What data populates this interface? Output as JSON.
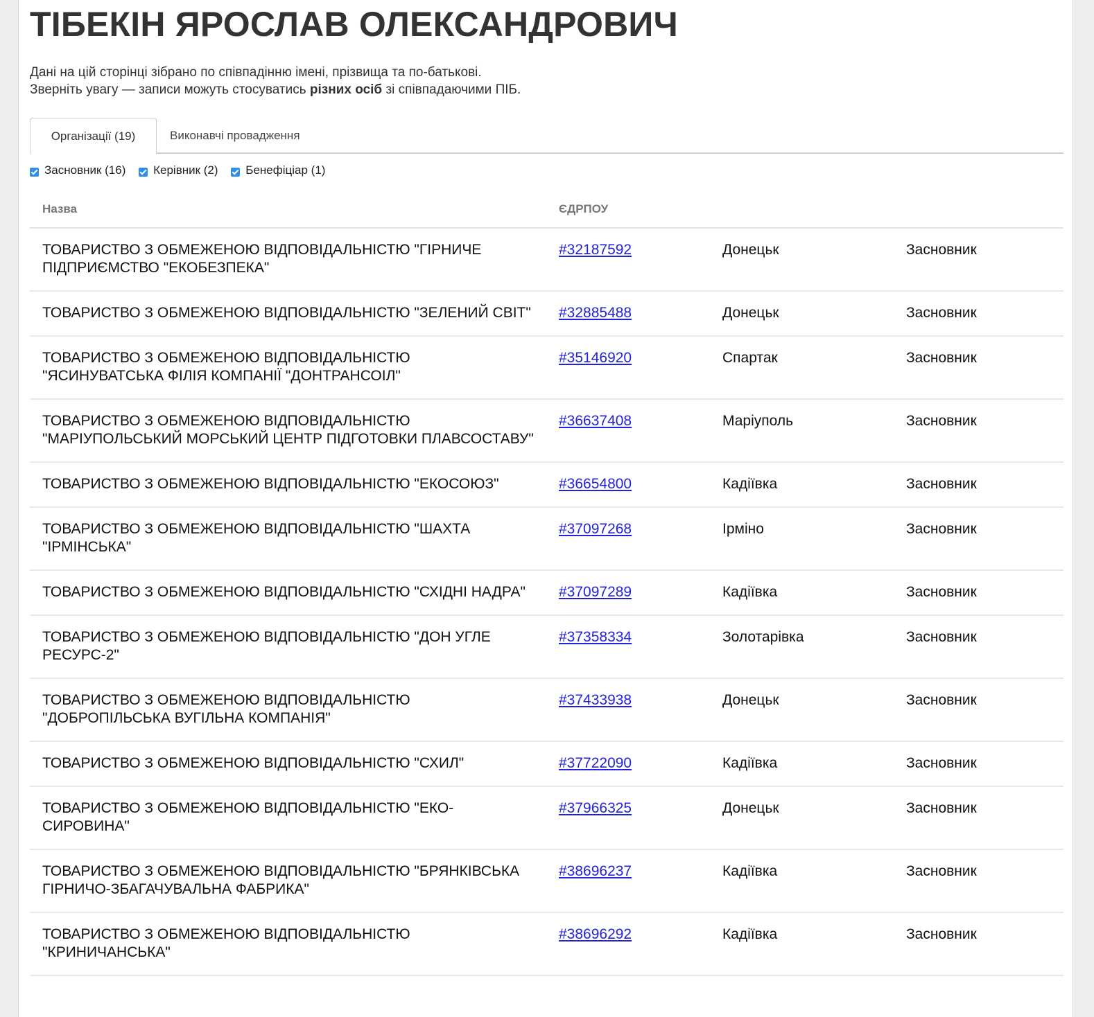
{
  "person": {
    "name": "ТІБЕКІН ЯРОСЛАВ ОЛЕКСАНДРОВИЧ"
  },
  "notice": {
    "line1": "Дані на цій сторінці зібрано по співпадінню імені, прізвища та по-батькові.",
    "line2_before": "Зверніть увагу — записи можуть стосуватись ",
    "line2_bold": "різних осіб",
    "line2_after": " зі співпадаючими ПІБ."
  },
  "tabs": [
    {
      "label": "Організації (19)",
      "active": true
    },
    {
      "label": "Виконавчі провадження",
      "active": false
    }
  ],
  "filters": [
    {
      "label": "Засновник (16)",
      "checked": true
    },
    {
      "label": "Керівник (2)",
      "checked": true
    },
    {
      "label": "Бенефіціар (1)",
      "checked": true
    }
  ],
  "table": {
    "headers": {
      "name": "Назва",
      "code": "ЄДРПОУ"
    },
    "rows": [
      {
        "name": "ТОВАРИСТВО З ОБМЕЖЕНОЮ ВІДПОВІДАЛЬНІСТЮ \"ГІРНИЧЕ ПІДПРИЄМСТВО \"ЕКОБЕЗПЕКА\"",
        "code": "#32187592",
        "city": "Донецьк",
        "role": "Засновник"
      },
      {
        "name": "ТОВАРИСТВО З ОБМЕЖЕНОЮ ВІДПОВІДАЛЬНІСТЮ \"ЗЕЛЕНИЙ СВІТ\"",
        "code": "#32885488",
        "city": "Донецьк",
        "role": "Засновник"
      },
      {
        "name": "ТОВАРИСТВО З ОБМЕЖЕНОЮ ВІДПОВІДАЛЬНІСТЮ \"ЯСИНУВАТСЬКА ФІЛІЯ КОМПАНІЇ \"ДОНТРАНСОІЛ\"",
        "code": "#35146920",
        "city": "Спартак",
        "role": "Засновник"
      },
      {
        "name": "ТОВАРИСТВО З ОБМЕЖЕНОЮ ВІДПОВІДАЛЬНІСТЮ \"МАРІУПОЛЬСЬКИЙ МОРСЬКИЙ ЦЕНТР ПІДГОТОВКИ ПЛАВСОСТАВУ\"",
        "code": "#36637408",
        "city": "Маріуполь",
        "role": "Засновник"
      },
      {
        "name": "ТОВАРИСТВО З ОБМЕЖЕНОЮ ВІДПОВІДАЛЬНІСТЮ \"ЕКОСОЮЗ\"",
        "code": "#36654800",
        "city": "Кадіївка",
        "role": "Засновник"
      },
      {
        "name": "ТОВАРИСТВО З ОБМЕЖЕНОЮ ВІДПОВІДАЛЬНІСТЮ \"ШАХТА \"ІРМІНСЬКА\"",
        "code": "#37097268",
        "city": "Ірміно",
        "role": "Засновник"
      },
      {
        "name": "ТОВАРИСТВО З ОБМЕЖЕНОЮ ВІДПОВІДАЛЬНІСТЮ \"СХІДНІ НАДРА\"",
        "code": "#37097289",
        "city": "Кадіївка",
        "role": "Засновник"
      },
      {
        "name": "ТОВАРИСТВО З ОБМЕЖЕНОЮ ВІДПОВІДАЛЬНІСТЮ \"ДОН УГЛЕ РЕСУРС-2\"",
        "code": "#37358334",
        "city": "Золотарівка",
        "role": "Засновник"
      },
      {
        "name": "ТОВАРИСТВО З ОБМЕЖЕНОЮ ВІДПОВІДАЛЬНІСТЮ \"ДОБРОПІЛЬСЬКА ВУГІЛЬНА КОМПАНІЯ\"",
        "code": "#37433938",
        "city": "Донецьк",
        "role": "Засновник"
      },
      {
        "name": "ТОВАРИСТВО З ОБМЕЖЕНОЮ ВІДПОВІДАЛЬНІСТЮ \"СХИЛ\"",
        "code": "#37722090",
        "city": "Кадіївка",
        "role": "Засновник"
      },
      {
        "name": "ТОВАРИСТВО З ОБМЕЖЕНОЮ ВІДПОВІДАЛЬНІСТЮ \"ЕКО-СИРОВИНА\"",
        "code": "#37966325",
        "city": "Донецьк",
        "role": "Засновник"
      },
      {
        "name": "ТОВАРИСТВО З ОБМЕЖЕНОЮ ВІДПОВІДАЛЬНІСТЮ \"БРЯНКІВСЬКА ГІРНИЧО-ЗБАГАЧУВАЛЬНА ФАБРИКА\"",
        "code": "#38696237",
        "city": "Кадіївка",
        "role": "Засновник"
      },
      {
        "name": "ТОВАРИСТВО З ОБМЕЖЕНОЮ ВІДПОВІДАЛЬНІСТЮ \"КРИНИЧАНСЬКА\"",
        "code": "#38696292",
        "city": "Кадіївка",
        "role": "Засновник"
      }
    ]
  },
  "colors": {
    "link": "#2222dd",
    "checkbox": "#2f8fe8",
    "title": "#333333"
  }
}
